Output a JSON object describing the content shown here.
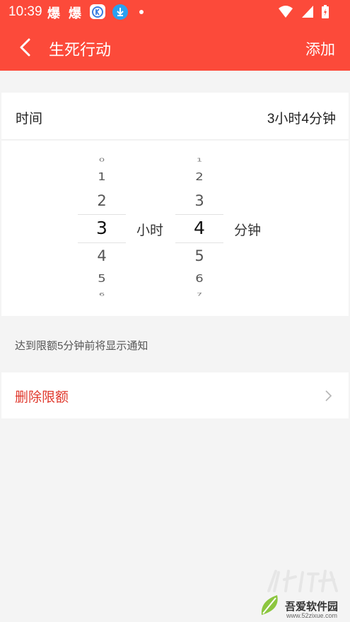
{
  "status_bar": {
    "time": "10:39",
    "boom_1": "爆",
    "boom_2": "爆"
  },
  "app_bar": {
    "title": "生死行动",
    "add_label": "添加"
  },
  "time_row": {
    "label": "时间",
    "value": "3小时4分钟"
  },
  "picker": {
    "hours": [
      "0",
      "1",
      "2",
      "3",
      "4",
      "5",
      "6"
    ],
    "selected_hour": "3",
    "hour_unit": "小时",
    "minutes": [
      "1",
      "2",
      "3",
      "4",
      "5",
      "6",
      "7"
    ],
    "selected_minute": "4",
    "minute_unit": "分钟"
  },
  "hint": "达到限额5分钟前将显示通知",
  "delete_label": "删除限额",
  "watermark": {
    "brand": "吾爱软件园",
    "url": "www.52zixue.com"
  },
  "colors": {
    "accent": "#fc4a3a",
    "delete_text": "#e0392d"
  }
}
